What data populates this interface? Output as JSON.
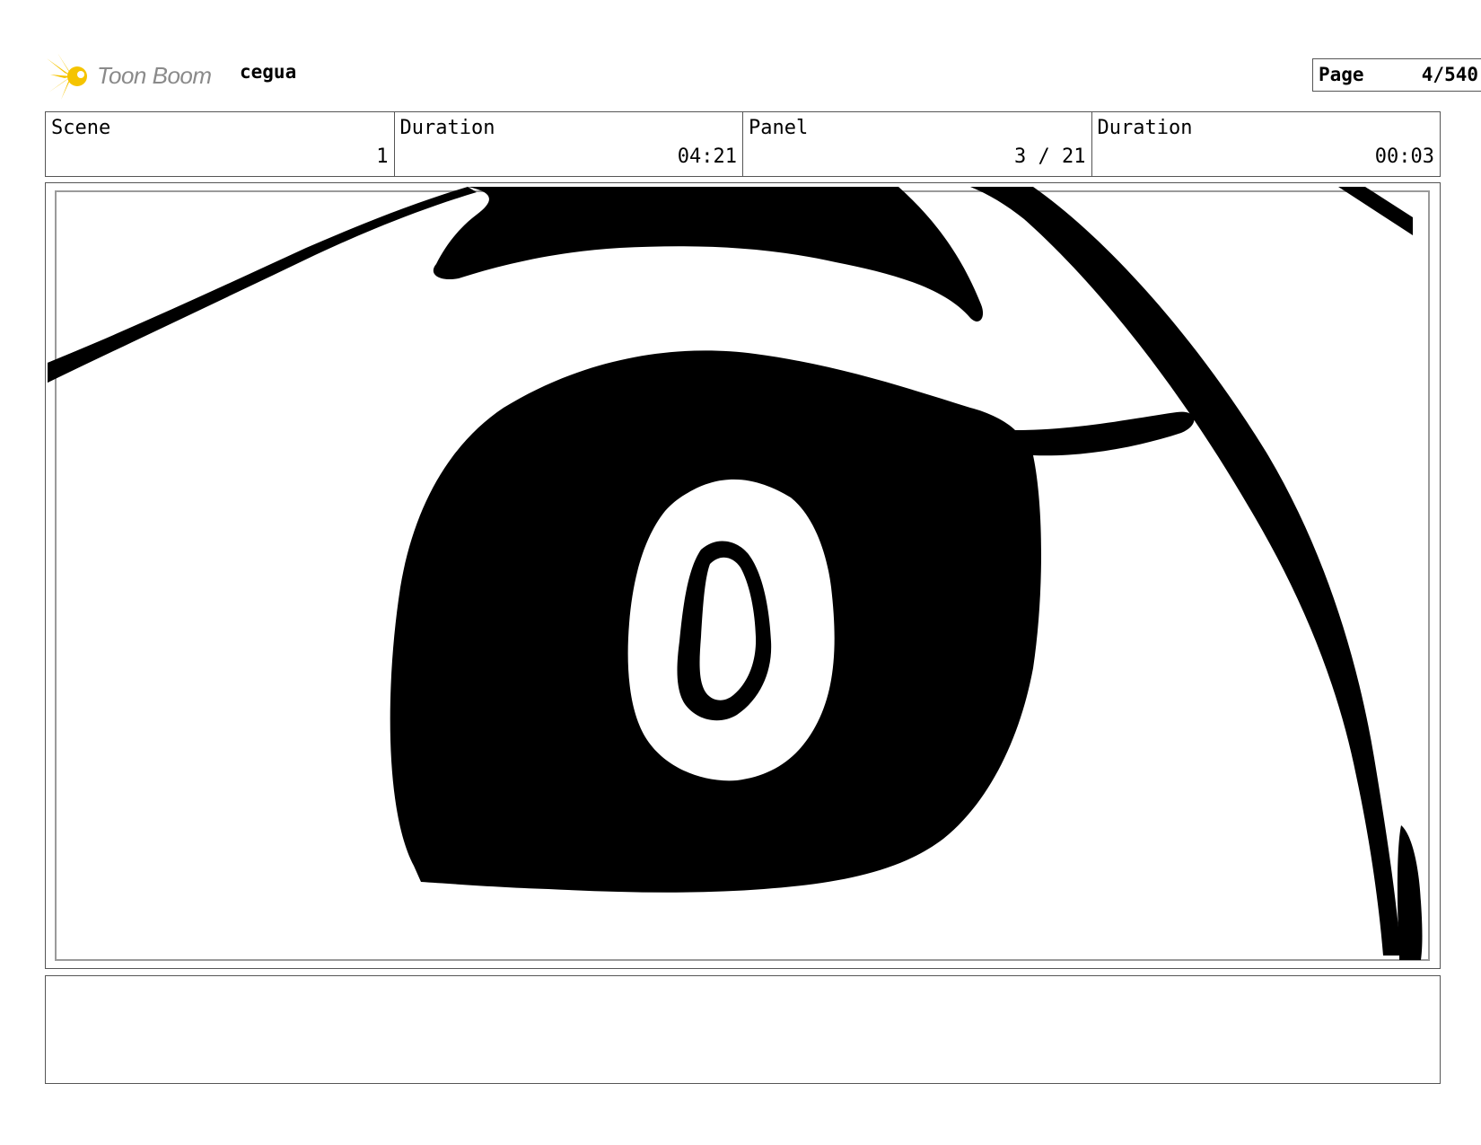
{
  "header": {
    "logo_text": "Toon Boom",
    "project_name": "cegua",
    "page_label": "Page",
    "page_value": "4/540"
  },
  "info": {
    "scene_label": "Scene",
    "scene_value": "1",
    "scene_duration_label": "Duration",
    "scene_duration_value": "04:21",
    "panel_label": "Panel",
    "panel_value": "3 / 21",
    "panel_duration_label": "Duration",
    "panel_duration_value": "00:03"
  },
  "colors": {
    "ink": "#000000",
    "logo_yellow": "#f5c400",
    "logo_gray": "#8a8a8a",
    "frame_border": "#555555"
  },
  "notes": {
    "text": ""
  }
}
